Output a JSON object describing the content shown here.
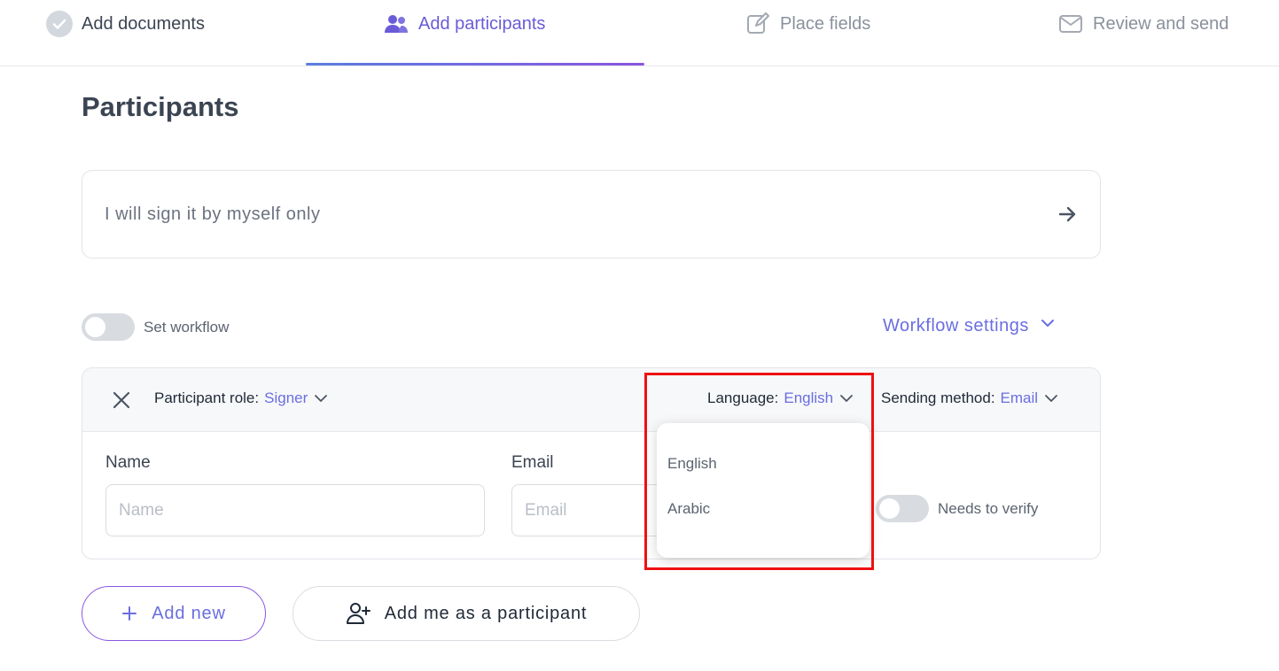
{
  "stepper": {
    "steps": [
      {
        "label": "Add documents",
        "icon": "check-circle-icon"
      },
      {
        "label": "Add participants",
        "icon": "users-icon"
      },
      {
        "label": "Place fields",
        "icon": "edit-icon"
      },
      {
        "label": "Review and send",
        "icon": "mail-icon"
      }
    ],
    "active_color": "#6a5bd8"
  },
  "page": {
    "title": "Participants"
  },
  "self_sign": {
    "label": "I will sign it by myself only",
    "icon": "arrow-right-icon"
  },
  "workflow": {
    "toggle_label": "Set workflow",
    "settings_label": "Workflow settings"
  },
  "participant": {
    "role_label": "Participant role:",
    "role_value": "Signer",
    "language_label": "Language:",
    "language_value": "English",
    "sending_label": "Sending method:",
    "sending_value": "Email",
    "name_label": "Name",
    "name_placeholder": "Name",
    "email_label": "Email",
    "email_placeholder": "Email",
    "verify_label": "Needs to verify"
  },
  "language_dropdown": {
    "options": [
      "English",
      "Arabic"
    ]
  },
  "actions": {
    "add_new": "Add new",
    "add_me": "Add me as a participant"
  },
  "colors": {
    "accent": "#6a6ee0",
    "highlight": "#ee1111"
  }
}
